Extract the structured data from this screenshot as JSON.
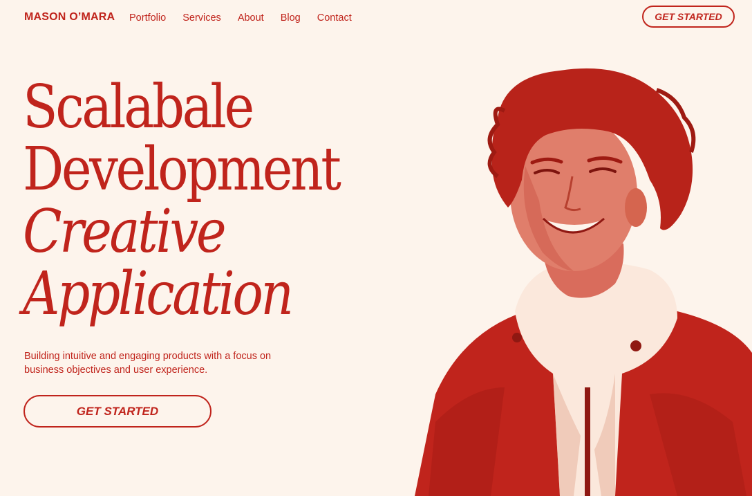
{
  "header": {
    "brand": "MASON O’MARA",
    "nav": [
      "Portfolio",
      "Services",
      "About",
      "Blog",
      "Contact"
    ],
    "cta_label": "GET STARTED"
  },
  "hero": {
    "title_lines": [
      "Scalabale",
      "Development",
      "Creative",
      "Application"
    ],
    "subtitle": "Building intuitive and engaging products with a focus on business objectives and user experience.",
    "cta_label": "GET STARTED"
  },
  "portrait": {
    "icon": "person-portrait-image"
  },
  "colors": {
    "accent": "#c0241c",
    "background": "#fdf4ec"
  }
}
